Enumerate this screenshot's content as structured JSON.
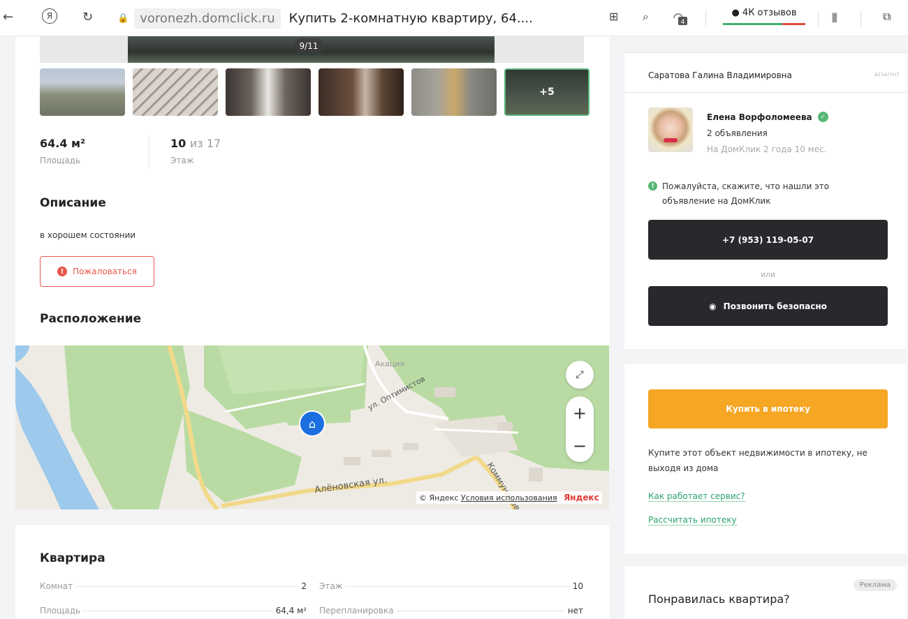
{
  "browser": {
    "domain": "voronezh.domclick.ru",
    "page_title": "Купить 2-комнатную квартиру, 64....",
    "reviews": "4К отзывов",
    "tab_count": "4"
  },
  "gallery": {
    "counter": "9/11",
    "more_photos": "+5"
  },
  "stats": {
    "area_value": "64.4 м²",
    "area_label": "Площадь",
    "floor_value": "10",
    "floor_suffix": "из 17",
    "floor_label": "Этаж"
  },
  "description": {
    "title": "Описание",
    "text": "в хорошем состоянии",
    "report_label": "Пожаловаться"
  },
  "location": {
    "title": "Расположение",
    "map_labels": {
      "akatsiya": "Акация",
      "optimistov": "ул. Оптимистов",
      "alenovskaya": "Алёновская ул.",
      "kommunarov": "Коммунаров"
    },
    "copyright": "© Яндекс",
    "terms": "Условия использования",
    "yandex": "Яндекс"
  },
  "apartment": {
    "title": "Квартира",
    "left": [
      {
        "key": "Комнат",
        "value": "2"
      },
      {
        "key": "Площадь",
        "value": "64,4 м²"
      }
    ],
    "right": [
      {
        "key": "Этаж",
        "value": "10"
      },
      {
        "key": "Перепланировка",
        "value": "нет"
      }
    ]
  },
  "seller": {
    "owner_name": "Саратова Галина Владимировна",
    "owner_tag": "БЕЗАГЕНТ",
    "agent_name": "Елена Ворфоломеева",
    "agent_listings": "2 объявления",
    "agent_since": "На ДомКлик 2 года 10 мес.",
    "info": "Пожалуйста, скажите, что нашли это объявление на ДомКлик",
    "phone": "+7 (953) 119-05-07",
    "or": "или",
    "safe_call": "Позвонить безопасно"
  },
  "mortgage": {
    "button": "Купить в ипотеку",
    "text": "Купите этот объект недвижимости в ипотеку, не выходя из дома",
    "how_link": "Как работает сервис?",
    "calc_link": "Рассчитать ипотеку"
  },
  "liked": {
    "ad_badge": "Реклама",
    "title": "Понравилась квартира?"
  }
}
